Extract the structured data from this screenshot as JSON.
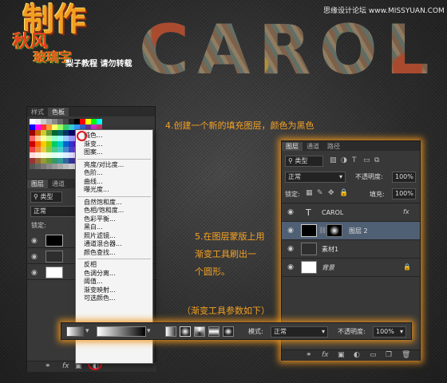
{
  "header": {
    "logo_line1": "制作",
    "logo_line2": "秋风",
    "logo_line3": "玻璃字",
    "slogan": "梨子教程 请勿转载",
    "watermark": "思缘设计论坛 www.MISSYUAN.COM",
    "carol_text": "CAROL"
  },
  "left_panel": {
    "tabs": [
      "样式",
      "色板"
    ],
    "layer_tabs": [
      "图层",
      "通道"
    ],
    "type_select": "类型",
    "blend_select": "正常",
    "lock_label": "锁定:",
    "footer_icon": "fx",
    "menu": {
      "groups": [
        [
          "纯色...",
          "渐变...",
          "图案..."
        ],
        [
          "亮度/对比度...",
          "色阶...",
          "曲线...",
          "曝光度..."
        ],
        [
          "自然饱和度...",
          "色相/饱和度...",
          "色彩平衡...",
          "黑白...",
          "照片滤镜...",
          "通道混合器...",
          "颜色查找..."
        ],
        [
          "反相",
          "色调分离...",
          "阈值...",
          "渐变映射...",
          "可选颜色..."
        ]
      ]
    }
  },
  "annotations": {
    "step4": "4.创建一个新的填充图层，颜色为黑色",
    "step5_l1": "5.在图层蒙版上用",
    "step5_l2": "渐变工具刷出一",
    "step5_l3": "个圆形。",
    "step5_note": "（渐变工具参数如下）"
  },
  "layers_panel": {
    "tabs": [
      "图层",
      "通道",
      "路径"
    ],
    "type_select": "类型",
    "blend_select": "正常",
    "opacity_label": "不透明度:",
    "opacity_value": "100%",
    "lock_label": "锁定:",
    "fill_label": "填充:",
    "fill_value": "100%",
    "layers": [
      {
        "name": "CAROL",
        "kind": "text",
        "badge": "fx"
      },
      {
        "name": "图层 2",
        "kind": "fill",
        "selected": true
      },
      {
        "name": "素材1",
        "kind": "image"
      },
      {
        "name": "背景",
        "kind": "background",
        "locked": true
      }
    ],
    "footer_icons": [
      "link-icon",
      "fx",
      "mask-icon",
      "adjustment-icon",
      "folder-icon",
      "new-layer-icon",
      "trash-icon"
    ],
    "footer_fx": "fx"
  },
  "gradient_bar": {
    "mode_label": "模式:",
    "mode_value": "正常",
    "opacity_label": "不透明度:",
    "opacity_value": "100%"
  },
  "colors": {
    "accent": "#f5a225",
    "panel_bg": "#383838",
    "selected_row": "#4f5f74",
    "highlight_circle": "#e0141e"
  }
}
